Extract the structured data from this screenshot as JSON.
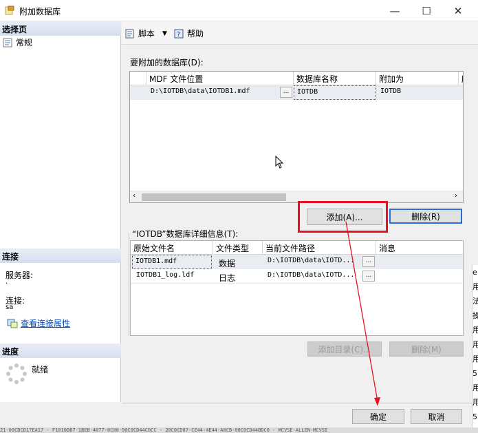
{
  "window": {
    "title": "附加数据库",
    "minimize": "—",
    "maximize": "☐",
    "close": "✕"
  },
  "left": {
    "select_page_header": "选择页",
    "pages": [
      {
        "label": "常规"
      }
    ],
    "connection_header": "连接",
    "server_label": "服务器:",
    "server_value": ".",
    "connection_label": "连接:",
    "connection_value": "sa",
    "view_properties_link": "查看连接属性",
    "progress_header": "进度",
    "progress_status": "就绪"
  },
  "toolbar": {
    "script_label": "脚本",
    "help_label": "帮助"
  },
  "attach_section": {
    "label": "要附加的数据库(D):",
    "columns": [
      "MDF 文件位置",
      "数据库名称",
      "附加为",
      "所"
    ],
    "rows": [
      {
        "mdf": "D:\\IOTDB\\data\\IOTDB1.mdf",
        "browse": "...",
        "db_name": "IOTDB",
        "attach_as": "IOTDB"
      }
    ]
  },
  "buttons": {
    "add": "添加(A)...",
    "remove": "删除(R)",
    "add_catalog": "添加目录(C)...",
    "remove_detail": "删除(M)",
    "ok": "确定",
    "cancel": "取消"
  },
  "details_section": {
    "label": "“IOTDB”数据库详细信息(T):",
    "columns": [
      "原始文件名",
      "文件类型",
      "当前文件路径",
      "消息"
    ],
    "rows": [
      {
        "name": "IOTDB1.mdf",
        "type": "数据",
        "path": "D:\\IOTDB\\data\\IOTD...",
        "browse": "..."
      },
      {
        "name": "IOTDB1_log.ldf",
        "type": "日志",
        "path": "D:\\IOTDB\\data\\IOTD...",
        "browse": "..."
      }
    ]
  },
  "status_bar": {
    "text": "21-00CDCD17EA17 - F1010DB7-1BEB-4077-0C00-00C0CD44COCC - 20C0CD07-CE44-4E44-A0CB-00C0CD44BDC0 - MCVSE-ALLEN-MCVSE"
  },
  "right_strip": {
    "chars": [
      "e",
      "用",
      "法",
      "操",
      "用",
      "用",
      "用",
      "5",
      "用",
      "用",
      "5"
    ]
  },
  "annotation": {
    "color": "#e81123"
  }
}
